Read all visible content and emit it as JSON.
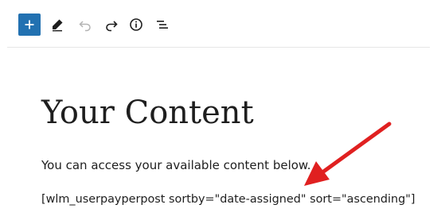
{
  "toolbar": {
    "buttons": [
      {
        "name": "add-block",
        "icon": "plus-icon"
      },
      {
        "name": "tools",
        "icon": "pencil-icon"
      },
      {
        "name": "undo",
        "icon": "undo-icon",
        "disabled": true
      },
      {
        "name": "redo",
        "icon": "redo-icon"
      },
      {
        "name": "details",
        "icon": "info-icon"
      },
      {
        "name": "document-overview",
        "icon": "list-view-icon"
      }
    ]
  },
  "colors": {
    "accent": "#2271b1",
    "text": "#1e1e1e",
    "disabled": "#b4b4b4",
    "annotation_arrow": "#e02020"
  },
  "content": {
    "title": "Your Content",
    "intro": "You can access your available content below.",
    "shortcode": "[wlm_userpayperpost sortby=\"date-assigned\" sort=\"ascending\"]"
  }
}
